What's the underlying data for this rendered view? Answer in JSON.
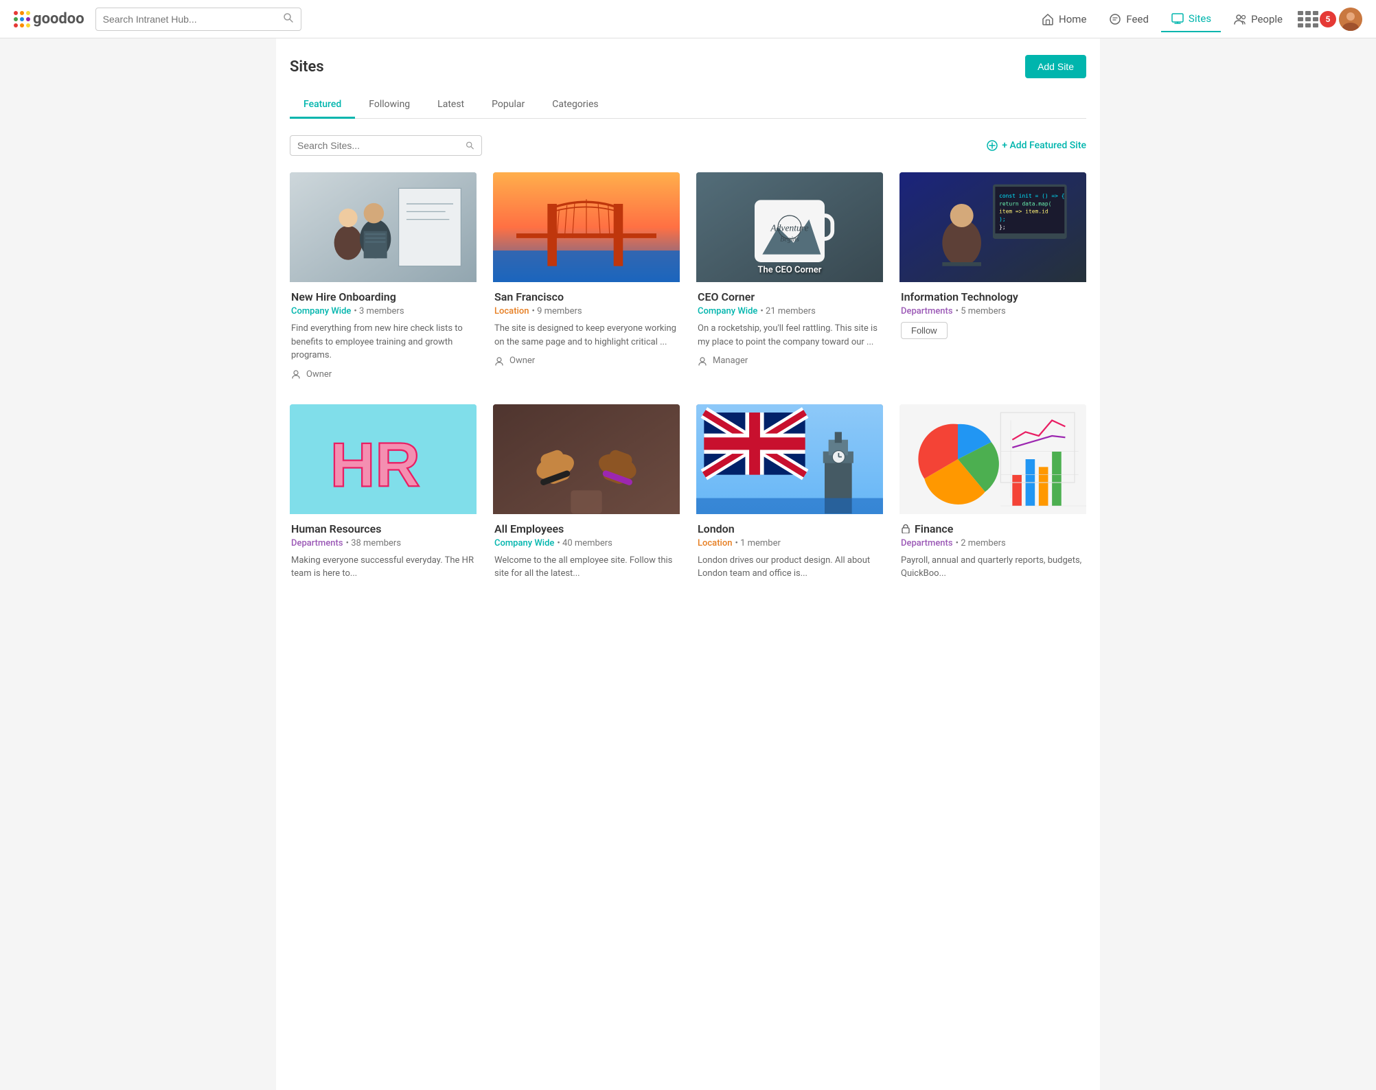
{
  "header": {
    "logo_text": "goodoo",
    "search_placeholder": "Search Intranet Hub...",
    "nav": [
      {
        "id": "home",
        "label": "Home",
        "active": false
      },
      {
        "id": "feed",
        "label": "Feed",
        "active": false
      },
      {
        "id": "sites",
        "label": "Sites",
        "active": true
      },
      {
        "id": "people",
        "label": "People",
        "active": false
      }
    ],
    "notification_count": "5"
  },
  "page": {
    "title": "Sites",
    "add_site_label": "Add Site",
    "tabs": [
      {
        "id": "featured",
        "label": "Featured",
        "active": true
      },
      {
        "id": "following",
        "label": "Following",
        "active": false
      },
      {
        "id": "latest",
        "label": "Latest",
        "active": false
      },
      {
        "id": "popular",
        "label": "Popular",
        "active": false
      },
      {
        "id": "categories",
        "label": "Categories",
        "active": false
      }
    ],
    "search_sites_placeholder": "Search Sites...",
    "add_featured_label": "+ Add Featured Site"
  },
  "sites": [
    {
      "id": "new-hire-onboarding",
      "title": "New Hire Onboarding",
      "category": "Company Wide",
      "category_type": "company-wide",
      "members": "3 members",
      "description": "Find everything from new hire check lists to benefits to employee training and growth programs.",
      "role": "Owner",
      "image_type": "onboarding",
      "locked": false
    },
    {
      "id": "san-francisco",
      "title": "San Francisco",
      "category": "Location",
      "category_type": "location",
      "members": "9 members",
      "description": "The site is designed to keep everyone working on the same page and to highlight critical ...",
      "role": "Owner",
      "image_type": "sf",
      "locked": false
    },
    {
      "id": "ceo-corner",
      "title": "CEO Corner",
      "category": "Company Wide",
      "category_type": "company-wide",
      "members": "21 members",
      "description": "On a rocketship, you'll feel rattling. This site is my place to point the company toward our ...",
      "role": "Manager",
      "image_type": "ceo",
      "locked": false,
      "image_label": "The CEO Corner"
    },
    {
      "id": "information-technology",
      "title": "Information Technology",
      "category": "Departments",
      "category_type": "departments",
      "members": "5 members",
      "description": "",
      "role": "",
      "image_type": "it",
      "locked": false,
      "show_follow": true
    },
    {
      "id": "human-resources",
      "title": "Human Resources",
      "category": "Departments",
      "category_type": "departments",
      "members": "38 members",
      "description": "Making everyone successful everyday. The HR team is here to...",
      "role": "",
      "image_type": "hr",
      "locked": false
    },
    {
      "id": "all-employees",
      "title": "All Employees",
      "category": "Company Wide",
      "category_type": "company-wide",
      "members": "40 members",
      "description": "Welcome to the all employee site. Follow this site for all the latest...",
      "role": "",
      "image_type": "all-emp",
      "locked": false
    },
    {
      "id": "london",
      "title": "London",
      "category": "Location",
      "category_type": "location",
      "members": "1 member",
      "description": "London drives our product design. All about London team and office is...",
      "role": "",
      "image_type": "london",
      "locked": false
    },
    {
      "id": "finance",
      "title": "Finance",
      "category": "Departments",
      "category_type": "departments",
      "members": "2 members",
      "description": "Payroll, annual and quarterly reports, budgets, QuickBoo...",
      "role": "",
      "image_type": "finance",
      "locked": true
    }
  ],
  "labels": {
    "follow": "Follow",
    "owner": "Owner",
    "manager": "Manager"
  }
}
